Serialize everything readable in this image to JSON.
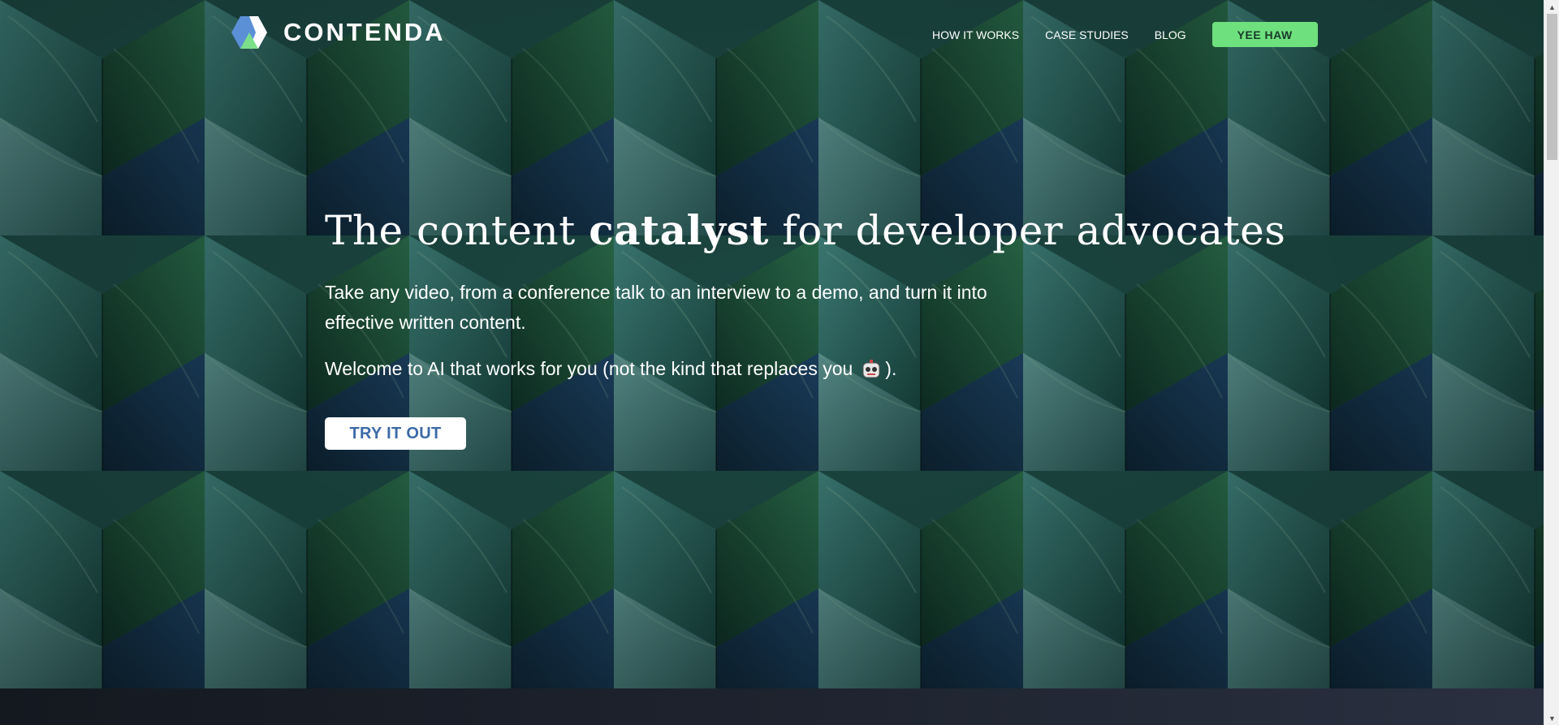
{
  "brand": {
    "name": "CONTENDA",
    "logo_icon": "hexagon-logo-icon",
    "colors": {
      "blue": "#5b8fd6",
      "green": "#7be08a",
      "white": "#ffffff"
    }
  },
  "nav": {
    "items": [
      {
        "label": "HOW IT WORKS"
      },
      {
        "label": "CASE STUDIES"
      },
      {
        "label": "BLOG"
      }
    ],
    "cta_label": "YEE HAW",
    "cta_color": "#6ee07e"
  },
  "hero": {
    "title_pre": "The content ",
    "title_bold": "catalyst",
    "title_post": " for developer advocates",
    "description": "Take any video, from a conference talk to an interview to a demo, and turn it into effective written content.",
    "welcome_pre": "Welcome to AI that works for you (not the kind that replaces you",
    "welcome_icon": "robot-face-icon",
    "welcome_post": ").",
    "button_label": "TRY IT OUT",
    "button_text_color": "#3b6aa8"
  },
  "scrollbar": {
    "up_icon": "scroll-up-arrow-icon",
    "down_icon": "scroll-down-arrow-icon"
  }
}
